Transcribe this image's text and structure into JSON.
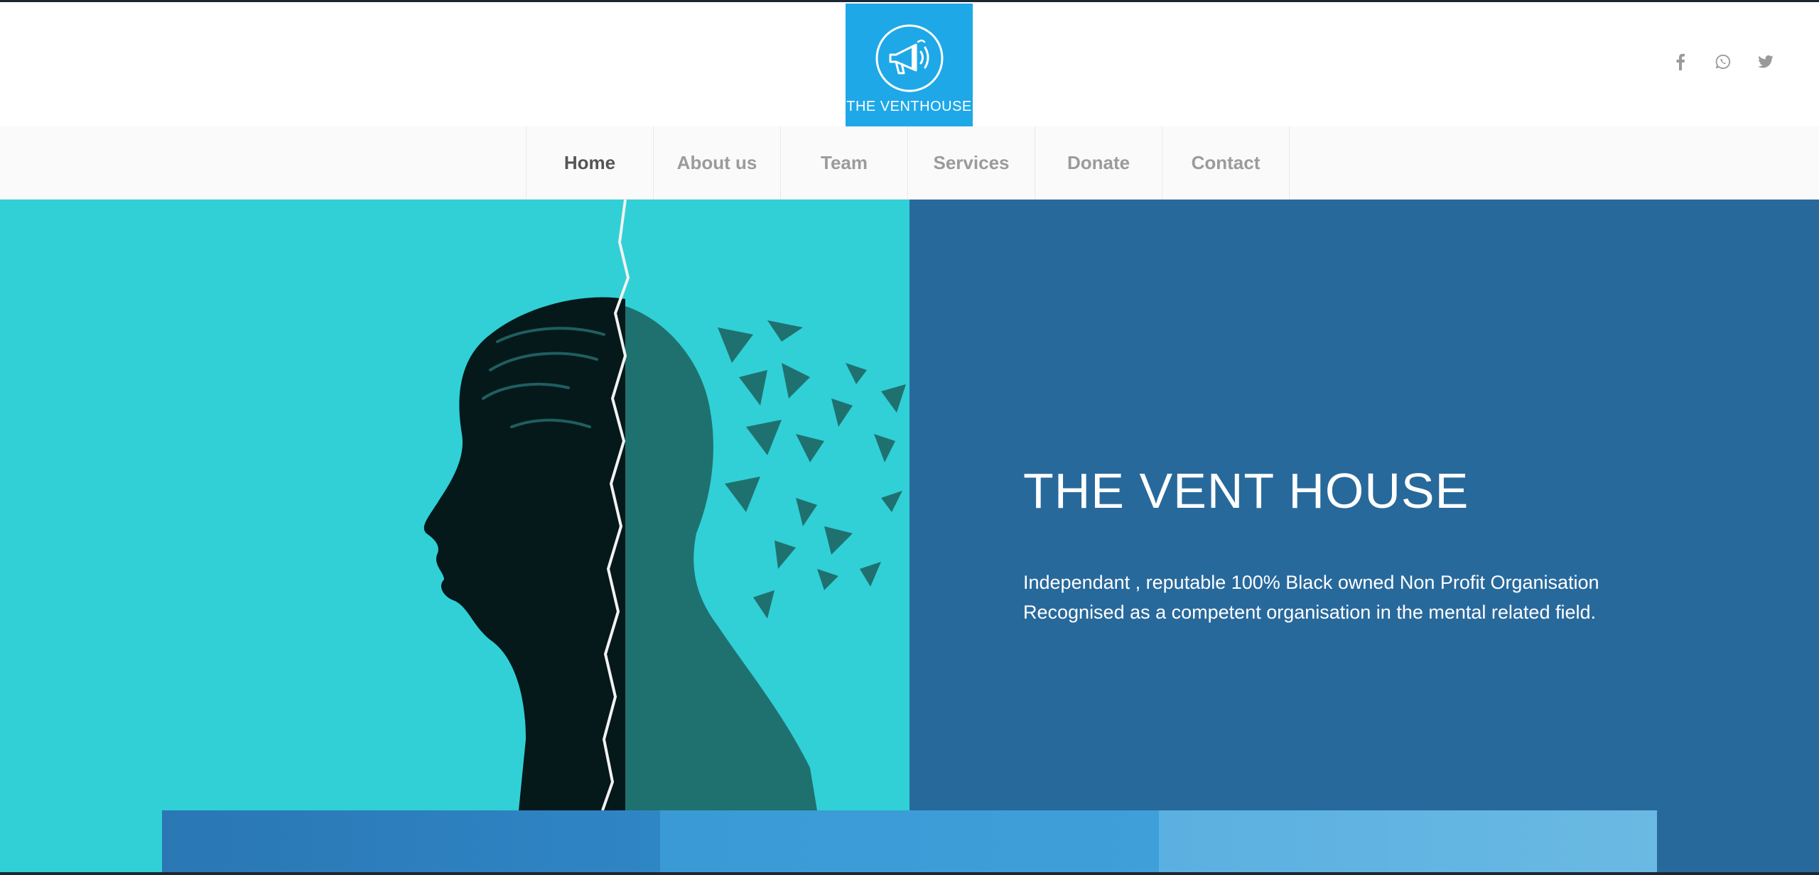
{
  "brand": {
    "logo_text": "THE VENTHOUSE",
    "logo_icon": "megaphone-icon",
    "logo_color": "#1ea8e8"
  },
  "social": [
    {
      "name": "facebook",
      "icon": "facebook-icon"
    },
    {
      "name": "whatsapp",
      "icon": "whatsapp-icon"
    },
    {
      "name": "twitter",
      "icon": "twitter-icon"
    }
  ],
  "nav": {
    "items": [
      {
        "label": "Home",
        "active": true
      },
      {
        "label": "About us",
        "active": false
      },
      {
        "label": "Team",
        "active": false
      },
      {
        "label": "Services",
        "active": false
      },
      {
        "label": "Donate",
        "active": false
      },
      {
        "label": "Contact",
        "active": false
      }
    ]
  },
  "hero": {
    "title": "THE VENT HOUSE",
    "description_lines": [
      "Independant , reputable  100% Black  owned Non Profit  Organisation",
      "Recognised as  a competent organisation in the mental related field."
    ],
    "left_color": "#30d0d6",
    "right_color": "#28699c"
  },
  "colors": {
    "accent": "#1ea8e8",
    "nav_text": "#9b9b9b",
    "nav_active": "#555555"
  }
}
